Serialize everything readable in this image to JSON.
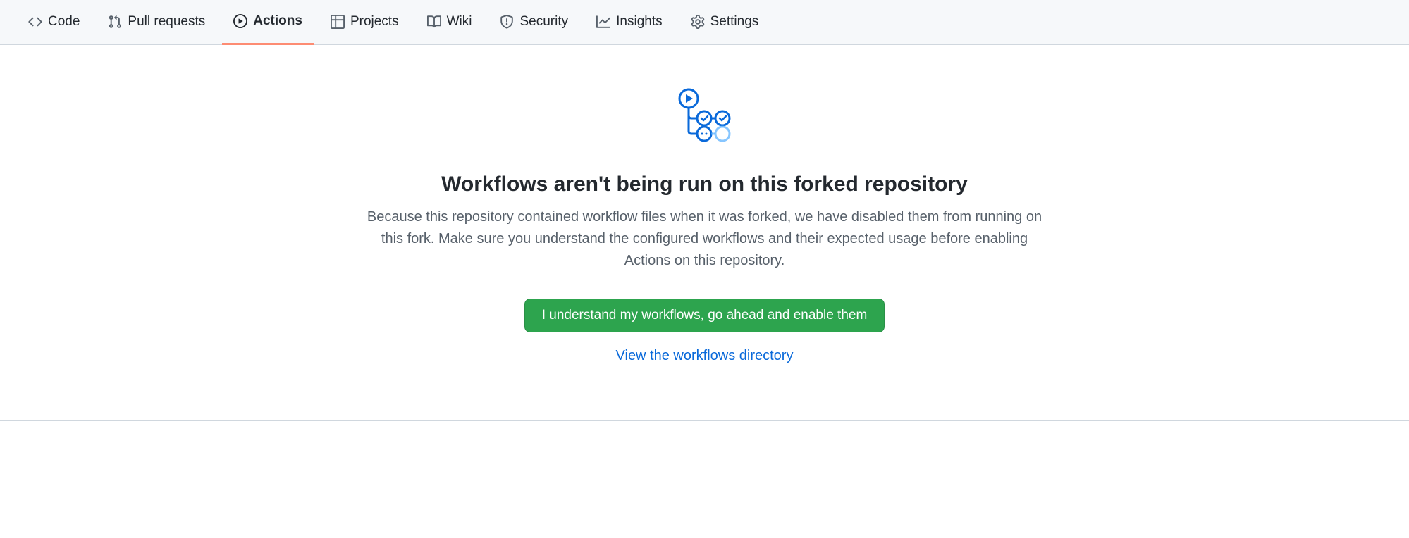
{
  "nav": {
    "tabs": [
      {
        "label": "Code"
      },
      {
        "label": "Pull requests"
      },
      {
        "label": "Actions"
      },
      {
        "label": "Projects"
      },
      {
        "label": "Wiki"
      },
      {
        "label": "Security"
      },
      {
        "label": "Insights"
      },
      {
        "label": "Settings"
      }
    ]
  },
  "main": {
    "heading": "Workflows aren't being run on this forked repository",
    "description": "Because this repository contained workflow files when it was forked, we have disabled them from running on this fork. Make sure you understand the configured workflows and their expected usage before enabling Actions on this repository.",
    "enable_button_label": "I understand my workflows, go ahead and enable them",
    "view_link_label": "View the workflows directory"
  }
}
